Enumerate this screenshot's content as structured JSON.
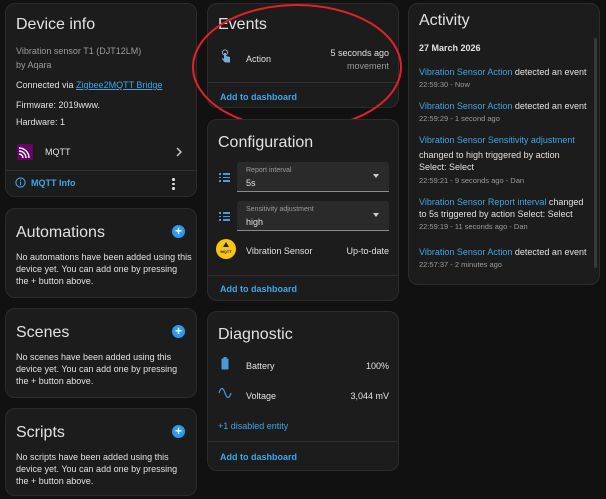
{
  "device_info": {
    "title": "Device info",
    "model": "Vibration sensor T1 (DJT12LM)",
    "manufacturer": "by Aqara",
    "connected_prefix": "Connected via ",
    "connected_link": "Zigbee2MQTT Bridge",
    "firmware": "Firmware: 2019www.",
    "hardware": "Hardware: 1",
    "integration": "MQTT",
    "info_button": "MQTT Info"
  },
  "automations": {
    "title": "Automations",
    "text": "No automations have been added using this device yet. You can add one by pressing the + button above."
  },
  "scenes": {
    "title": "Scenes",
    "text": "No scenes have been added using this device yet. You can add one by pressing the + button above."
  },
  "scripts": {
    "title": "Scripts",
    "text": "No scripts have been added using this device yet. You can add one by pressing the + button above."
  },
  "events": {
    "title": "Events",
    "action_label": "Action",
    "action_time": "5 seconds ago",
    "action_value": "movement",
    "add_link": "Add to dashboard"
  },
  "configuration": {
    "title": "Configuration",
    "report_interval_label": "Report interval",
    "report_interval_value": "5s",
    "sensitivity_label": "Sensitivity adjustment",
    "sensitivity_value": "high",
    "update_label": "Vibration Sensor",
    "update_value": "Up-to-date",
    "update_icon_text": "MQTT",
    "add_link": "Add to dashboard"
  },
  "diagnostic": {
    "title": "Diagnostic",
    "battery_label": "Battery",
    "battery_value": "100%",
    "voltage_label": "Voltage",
    "voltage_value": "3,044 mV",
    "disabled_link": "+1 disabled entity",
    "add_link": "Add to dashboard"
  },
  "activity": {
    "title": "Activity",
    "date": "27 March 2026",
    "entries": [
      {
        "entity": "Vibration Sensor Action",
        "text": " detected an event",
        "meta": "22:59:30 - Now"
      },
      {
        "entity": "Vibration Sensor Action",
        "text": " detected an event",
        "meta": "22:59:29 - 1 second ago"
      },
      {
        "entity": "Vibration Sensor Sensitivity adjustment",
        "text": "changed to high triggered by action Select: Select",
        "meta": "22:59:21 - 9 seconds ago - Dan"
      },
      {
        "entity": "Vibration Sensor Report interval",
        "text": " changed to 5s triggered by action Select: Select",
        "meta": "22:59:19 - 11 seconds ago - Dan"
      },
      {
        "entity": "Vibration Sensor Action",
        "text": " detected an event",
        "meta": "22:57:37 - 2 minutes ago"
      }
    ]
  },
  "colors": {
    "accent": "#3ea6e6",
    "annotation_circle": "#e0202a"
  }
}
